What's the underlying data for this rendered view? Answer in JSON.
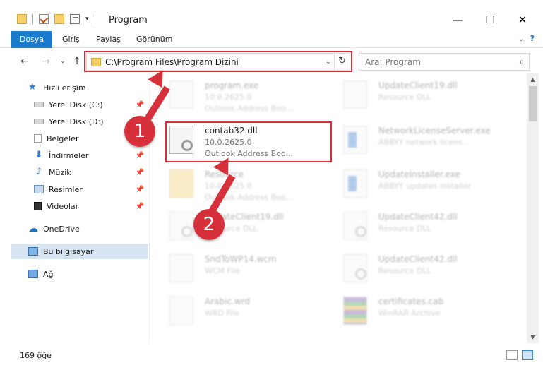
{
  "window": {
    "title": "Program",
    "minimize": "—",
    "maximize": "☐",
    "close": "✕"
  },
  "ribbon": {
    "tabs": [
      "Dosya",
      "Giriş",
      "Paylaş",
      "Görünüm"
    ],
    "help": "?"
  },
  "address": {
    "path": "C:\\Program Files\\Program Dizini",
    "dropdown": "⌄",
    "refresh": "↻"
  },
  "search": {
    "placeholder": "Ara: Program"
  },
  "sidebar": {
    "items": [
      {
        "label": "Hızlı erişim"
      },
      {
        "label": "Yerel Disk (C:)",
        "pinned": true
      },
      {
        "label": "Yerel Disk (D:)",
        "pinned": true
      },
      {
        "label": "Belgeler",
        "pinned": true
      },
      {
        "label": "İndirmeler",
        "pinned": true
      },
      {
        "label": "Müzik",
        "pinned": true
      },
      {
        "label": "Resimler",
        "pinned": true
      },
      {
        "label": "Videolar",
        "pinned": true
      },
      {
        "label": "OneDrive"
      },
      {
        "label": "Bu bilgisayar",
        "selected": true
      },
      {
        "label": "Ağ"
      }
    ],
    "pin_glyph": "📌"
  },
  "files": {
    "left": [
      {
        "name": "program.exe",
        "version": "10.0.2625.0",
        "desc": "Outlook Address Boo..."
      },
      {
        "name": "contab32.dll",
        "version": "10.0.2625.0",
        "desc": "Outlook Address Boo..."
      },
      {
        "name": "Resource",
        "version": "10.0.2625.0",
        "desc": "Outlook Address Boo..."
      },
      {
        "name": "UpdateClient19.dll",
        "version": "",
        "desc": "Resource DLL"
      },
      {
        "name": "SndToWP14.wcm",
        "version": "",
        "desc": "WCM File"
      },
      {
        "name": "Arabic.wrd",
        "version": "",
        "desc": "WRD File"
      }
    ],
    "right": [
      {
        "name": "UpdateClient19.dll",
        "desc": "Resource DLL"
      },
      {
        "name": "NetworkLicenseServer.exe",
        "desc": "ABBYY network licens..."
      },
      {
        "name": "UpdateInstaller.exe",
        "desc": "ABBYY updates installer"
      },
      {
        "name": "UpdateClient42.dll",
        "desc": "Resource DLL"
      },
      {
        "name": "UpdateClient42.dll",
        "desc": "Resource DLL"
      },
      {
        "name": "certificates.cab",
        "desc": "WinRAR Archive"
      }
    ]
  },
  "callouts": [
    "1",
    "2"
  ],
  "status": {
    "count": "169 öğe"
  },
  "colors": {
    "accent": "#1979ca",
    "highlight": "#d6303a",
    "selected": "#d7e4f2"
  }
}
